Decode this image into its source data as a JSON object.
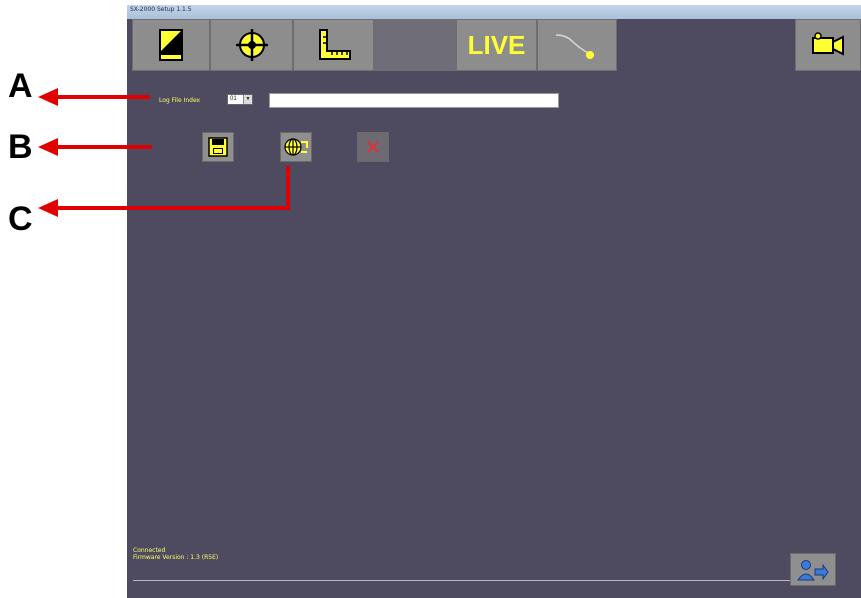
{
  "window": {
    "title": "SX-2000 Setup 1.1.5"
  },
  "toolbar": {
    "items": [
      {
        "id": "display",
        "icon": "display-settings-icon"
      },
      {
        "id": "target",
        "icon": "target-icon"
      },
      {
        "id": "measure",
        "icon": "ruler-corner-icon"
      },
      {
        "id": "blank",
        "icon": ""
      },
      {
        "id": "live",
        "label": "LIVE"
      },
      {
        "id": "connect",
        "icon": "cable-icon"
      },
      {
        "id": "camera",
        "icon": "video-camera-icon"
      }
    ]
  },
  "log": {
    "label": "Log File Index",
    "index_value": "01",
    "file_value": ""
  },
  "actions": {
    "save_icon": "floppy-disk-icon",
    "network_icon": "globe-transfer-icon",
    "delete_icon": "close-x-icon"
  },
  "status": {
    "line1": "Connected",
    "line2": "Firmware Version : 1.3 (R5E)"
  },
  "annotations": {
    "a": "A",
    "b": "B",
    "c": "C"
  },
  "colors": {
    "app_bg": "#4e4a60",
    "accent_yellow": "#ffff33",
    "callout_red": "#e00000",
    "button_gray": "#8d8d8d"
  }
}
